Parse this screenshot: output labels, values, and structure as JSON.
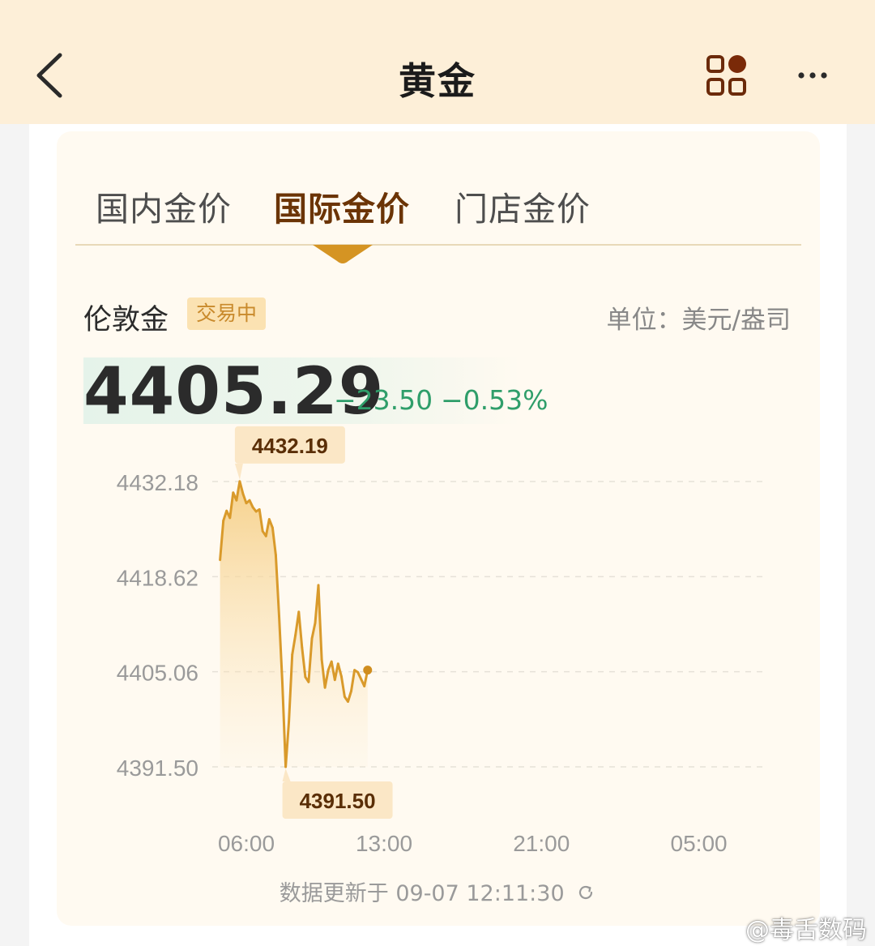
{
  "header": {
    "title": "黄金",
    "back_icon": "chevron-left-icon",
    "apps_icon": "grid-apps-icon",
    "more_icon": "more-dots-icon"
  },
  "tabs": [
    {
      "label": "国内金价",
      "active": false
    },
    {
      "label": "国际金价",
      "active": true
    },
    {
      "label": "门店金价",
      "active": false
    }
  ],
  "market": {
    "name": "伦敦金",
    "status": "交易中",
    "unit": "单位：美元/盎司"
  },
  "quote": {
    "price": "4405.29",
    "change": "−23.50",
    "change_pct": "−0.53%"
  },
  "colors": {
    "accent_brown": "#6b3406",
    "line": "#d99a2b",
    "down_green": "#2f9e6a",
    "header_bg": "#fdefd8"
  },
  "chart_data": {
    "type": "line",
    "title": "",
    "xlabel": "",
    "ylabel": "",
    "x_ticks": [
      "06:00",
      "13:00",
      "21:00",
      "05:00"
    ],
    "y_ticks": [
      "4432.18",
      "4418.62",
      "4405.06",
      "4391.50"
    ],
    "ylim": [
      4391.5,
      4432.18
    ],
    "grid": true,
    "high_label": "4432.19",
    "low_label": "4391.50",
    "series": [
      {
        "x": [
          "04:40",
          "04:50",
          "05:00",
          "05:10",
          "05:20",
          "05:30",
          "05:40",
          "05:50",
          "06:00",
          "06:10",
          "06:20",
          "06:30",
          "06:40",
          "06:50",
          "07:00",
          "07:10",
          "07:20",
          "07:30",
          "07:40",
          "07:50",
          "08:00",
          "08:10",
          "08:20",
          "08:30",
          "08:40",
          "08:50",
          "09:00",
          "09:10",
          "09:20",
          "09:30",
          "09:40",
          "09:50",
          "10:00",
          "10:10",
          "10:20",
          "10:30",
          "10:40",
          "10:50",
          "11:00",
          "11:10",
          "11:20",
          "11:30",
          "11:40",
          "11:50",
          "12:00",
          "12:10"
        ],
        "values": [
          4421.0,
          4426.6,
          4428.0,
          4427.0,
          4430.6,
          4429.5,
          4432.2,
          4430.4,
          4429.1,
          4429.5,
          4428.5,
          4427.9,
          4428.2,
          4425.1,
          4424.4,
          4426.8,
          4425.6,
          4421.7,
          4413.0,
          4403.5,
          4391.5,
          4398.0,
          4407.5,
          4410.3,
          4413.6,
          4408.5,
          4404.3,
          4403.6,
          4409.8,
          4412.0,
          4417.4,
          4406.8,
          4402.8,
          4405.3,
          4406.5,
          4403.9,
          4406.2,
          4404.4,
          4401.5,
          4400.8,
          4402.3,
          4405.3,
          4405.0,
          4404.0,
          4403.0,
          4405.3
        ]
      }
    ]
  },
  "footer": {
    "update_text": "数据更新于 09-07 12:11:30",
    "refresh_icon": "refresh-icon"
  },
  "watermark": "@毒舌数码"
}
